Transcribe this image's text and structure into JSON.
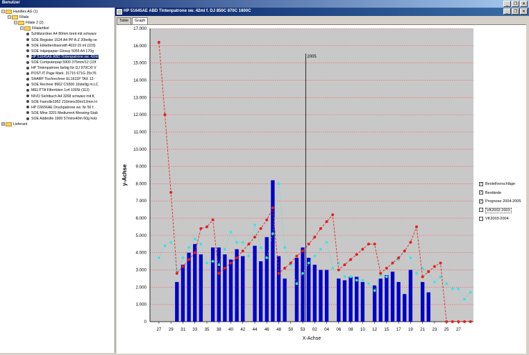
{
  "app": {
    "title": "Benutzer"
  },
  "window_buttons": [
    "_",
    "❐",
    "✕"
  ],
  "tree": {
    "nodes": [
      {
        "label": "Handles AG (1)",
        "type": "folder",
        "level": 0,
        "expanded": true
      },
      {
        "label": "Filiale",
        "type": "folder",
        "level": 1,
        "expanded": true
      },
      {
        "label": "Filiale 2 (2)",
        "type": "folder",
        "level": 2,
        "expanded": true
      },
      {
        "label": "Filialartikel",
        "type": "folder",
        "level": 3,
        "expanded": true
      },
      {
        "label": "Schlitzordner A4 80mm breit mit schwarz",
        "type": "item",
        "level": 4
      },
      {
        "label": "SOE Register 1524 A4 PP A-Z 20teilig ve",
        "type": "item",
        "level": 4
      },
      {
        "label": "SOE Etikettenlöserstift 4619 15 ml (103)",
        "type": "item",
        "level": 4
      },
      {
        "label": "SOE Inkjetpapier Glossy 5055 A4 170g",
        "type": "item",
        "level": 4
      },
      {
        "label": "HP 51645AE ABD Tintenpatrone sw. 42ml",
        "type": "item",
        "level": 4,
        "selected": true
      },
      {
        "label": "SOE Computerpap 5900 375mm/12 (10f",
        "type": "item",
        "level": 4
      },
      {
        "label": "HP Tintenpatrone farbig für DJ 970CXI V",
        "type": "item",
        "level": 4
      },
      {
        "label": "POST-IT Page Mark. 31715 671G 25x76",
        "type": "item",
        "level": 4
      },
      {
        "label": "SHARP Tischrechner EL1611P TAX 12-",
        "type": "item",
        "level": 4
      },
      {
        "label": "SOE Rechner 8662 CS500 10stellig m.LC",
        "type": "item",
        "level": 4
      },
      {
        "label": "MELITTA Filtertüten 1x4 100St (112)",
        "type": "item",
        "level": 4
      },
      {
        "label": "NIVO Sichtbuch A4 3268 schwarz mit K",
        "type": "item",
        "level": 4
      },
      {
        "label": "SOE Faxrolle1952 210mmx30m/12mm H",
        "type": "item",
        "level": 4
      },
      {
        "label": "HP C6656AE Druckpatrone sw. Nr 56 f.",
        "type": "item",
        "level": 4
      },
      {
        "label": "SOE Mine 3201 Mediumrot Messing-Stab",
        "type": "item",
        "level": 4
      },
      {
        "label": "SOE Addirolle 1900 57mmx40m 60g holz",
        "type": "item",
        "level": 4
      },
      {
        "label": "Lieferant",
        "type": "folder",
        "level": 0,
        "expanded": false
      }
    ]
  },
  "inner_window": {
    "title": "HP 51645AE ABD Tintenpatrone sw. 42ml f. DJ 850C 870C 1600C"
  },
  "tabs": [
    {
      "label": "Table",
      "active": false
    },
    {
      "label": "Graph",
      "active": true
    }
  ],
  "legend": [
    {
      "label": "Bestellvorschläge",
      "checked": true
    },
    {
      "label": "Bestände",
      "checked": true
    },
    {
      "label": "Prognose 2004-2005",
      "checked": true
    },
    {
      "label": "VK2002-2003",
      "checked": false,
      "boxed": true
    },
    {
      "label": "VK2003-2004",
      "checked": false
    }
  ],
  "chart_data": {
    "type": "bar",
    "xlabel": "X-Achse",
    "ylabel": "y-Achse",
    "ylim": [
      0,
      17000
    ],
    "y_ticks": [
      "0",
      "1.000",
      "2.000",
      "3.000",
      "4.000",
      "5.000",
      "6.000",
      "7.000",
      "8.000",
      "9.000",
      "10.000",
      "11.000",
      "12.000",
      "13.000",
      "14.000",
      "15.000",
      "16.000",
      "17.000"
    ],
    "x_tick_labels": [
      "27",
      "29",
      "31",
      "33",
      "35",
      "38",
      "40",
      "42",
      "44",
      "46",
      "48",
      "50",
      "53",
      "02",
      "04",
      "06",
      "08",
      "10",
      "12",
      "15",
      "17",
      "19",
      "21",
      "23",
      "25",
      "27"
    ],
    "marker": {
      "label": "2005",
      "index": 26
    },
    "grid": true,
    "colors": {
      "bars": "#0000cc",
      "forecast": "#e02020",
      "prognosis": "#40e0e0",
      "marker": "#000000",
      "plot_bg": "#c8c8c8",
      "grid": "#ff5050"
    },
    "series": [
      {
        "name": "Bestände",
        "kind": "bar",
        "values": [
          null,
          null,
          null,
          null,
          2300,
          3300,
          4000,
          4500,
          3900,
          null,
          4300,
          4300,
          3900,
          3600,
          4200,
          3800,
          null,
          4400,
          3500,
          4900,
          8200,
          3800,
          2500,
          null,
          3700,
          4300,
          3700,
          3300,
          3000,
          3000,
          null,
          2500,
          2400,
          2600,
          2600,
          2300,
          null,
          2100,
          2500,
          2700,
          2900,
          2300,
          1600,
          3000,
          null,
          2300,
          1700,
          null,
          null,
          null,
          null,
          null,
          null,
          null
        ]
      },
      {
        "name": "Bestellvorschläge",
        "kind": "line",
        "values": [
          null,
          16200,
          12000,
          7500,
          2800,
          3200,
          3600,
          4000,
          5400,
          5500,
          5900,
          2800,
          3100,
          3400,
          3700,
          4100,
          4500,
          4900,
          5400,
          5900,
          6600,
          2800,
          3100,
          3400,
          3800,
          4100,
          4500,
          4900,
          5400,
          5800,
          6200,
          3000,
          3300,
          3600,
          3900,
          4200,
          4500,
          4500,
          2800,
          3100,
          3400,
          3700,
          4100,
          4600,
          5500,
          2600,
          2900,
          3200,
          3400,
          0,
          0,
          0,
          0,
          0
        ]
      },
      {
        "name": "Prognose 2004-2005",
        "kind": "points",
        "values": [
          null,
          3700,
          4400,
          4600,
          2900,
          3700,
          4300,
          4800,
          4500,
          3400,
          3500,
          3300,
          4200,
          5200,
          4600,
          4600,
          3800,
          5600,
          4300,
          3700,
          5100,
          8000,
          4300,
          3300,
          2200,
          2800,
          3400,
          3800,
          4200,
          4600,
          3100,
          3400,
          2600,
          2600,
          2400,
          2400,
          2200,
          1800,
          2700,
          2600,
          3400,
          3600,
          4100,
          3700,
          2800,
          3100,
          2900,
          2300,
          2600,
          2200,
          1900,
          1900,
          1300,
          1700
        ]
      }
    ]
  }
}
